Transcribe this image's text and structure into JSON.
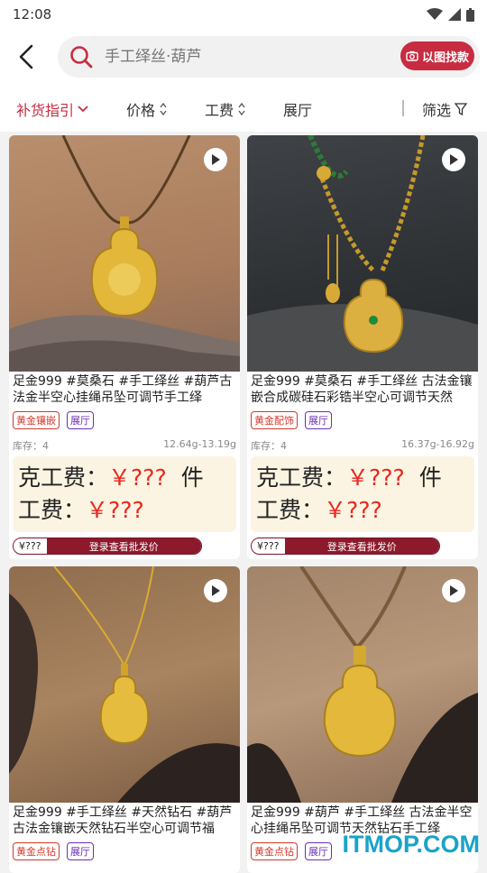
{
  "status": {
    "time": "12:08"
  },
  "search": {
    "placeholder": "手工绎丝·葫芦",
    "image_search_label": "以图找款"
  },
  "filters": {
    "sort": "补货指引",
    "price": "价格",
    "fee": "工费",
    "showroom": "展厅",
    "filter": "筛选"
  },
  "products": [
    {
      "title": "足金999 #莫桑石 #手工绎丝 #葫芦古法金半空心挂绳吊坠可调节手工绎",
      "tags": [
        "黄金镶嵌",
        "展厅"
      ],
      "stock": "库存：4",
      "weight": "12.64g-13.19g",
      "gram_fee_label": "克工费：",
      "gram_fee_value": "￥???",
      "piece_label": "件",
      "fee_label": "工费：",
      "fee_value": "￥???",
      "price_tag": "¥???",
      "login_text": "登录查看批发价"
    },
    {
      "title": "足金999 #莫桑石 #手工绎丝 古法金镶嵌合成碳硅石彩锆半空心可调节天然",
      "tags": [
        "黄金配饰",
        "展厅"
      ],
      "stock": "库存：4",
      "weight": "16.37g-16.92g",
      "gram_fee_label": "克工费：",
      "gram_fee_value": "￥???",
      "piece_label": "件",
      "fee_label": "工费：",
      "fee_value": "￥???",
      "price_tag": "¥???",
      "login_text": "登录查看批发价"
    },
    {
      "title": "足金999 #手工绎丝 #天然钻石 #葫芦古法金镶嵌天然钻石半空心可调节福",
      "tags": [
        "黄金点钻",
        "展厅"
      ]
    },
    {
      "title": "足金999 #葫芦 #手工绎丝 古法金半空心挂绳吊坠可调节天然钻石手工绎",
      "tags": [
        "黄金点钻",
        "展厅"
      ]
    }
  ],
  "watermark": "ITMOP.COM",
  "colors": {
    "accent": "#c72c41",
    "price_red": "#e8281f",
    "price_bg": "#fcf4e2",
    "tag_red": "#d23a2d",
    "tag_purple": "#6b2fb3"
  }
}
